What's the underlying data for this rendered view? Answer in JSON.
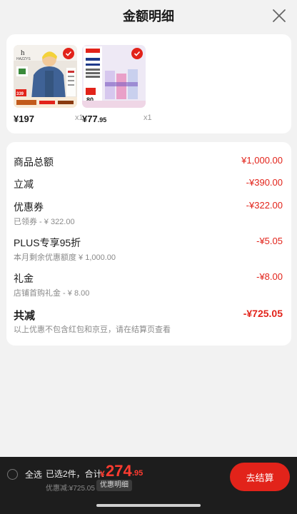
{
  "header": {
    "title": "金额明细",
    "close_icon": "close-icon"
  },
  "products": [
    {
      "price_int": "¥197",
      "price_dec": "",
      "qty": "x1",
      "checked": true
    },
    {
      "price_int": "¥77",
      "price_dec": ".95",
      "qty": "x1",
      "checked": true
    }
  ],
  "summary": {
    "total_goods": {
      "label": "商品总额",
      "value": "¥1,000.00"
    },
    "instant_off": {
      "label": "立减",
      "value": "-¥390.00"
    },
    "coupon": {
      "label": "优惠券",
      "value": "-¥322.00",
      "sub": "已领券 - ¥ 322.00"
    },
    "plus": {
      "label": "PLUS专享95折",
      "value": "-¥5.05",
      "sub": "本月剩余优惠额度 ¥ 1,000.00"
    },
    "gift": {
      "label": "礼金",
      "value": "-¥8.00",
      "sub": "店铺首购礼金 - ¥ 8.00"
    },
    "total_off": {
      "label": "共减",
      "value": "-¥725.05",
      "sub": "以上优惠不包含红包和京豆，请在结算页查看"
    }
  },
  "bottom_bar": {
    "select_all": "全选",
    "count_text": "已选2件，合计:",
    "yen": "¥",
    "total_int": "274",
    "total_dec": ".95",
    "discount_text": "优惠减:¥725.05",
    "detail_button": "优惠明细",
    "checkout_button": "去结算"
  },
  "colors": {
    "accent": "#e2231a",
    "bar": "#1d1d1d",
    "bg": "#f2f2f2"
  }
}
